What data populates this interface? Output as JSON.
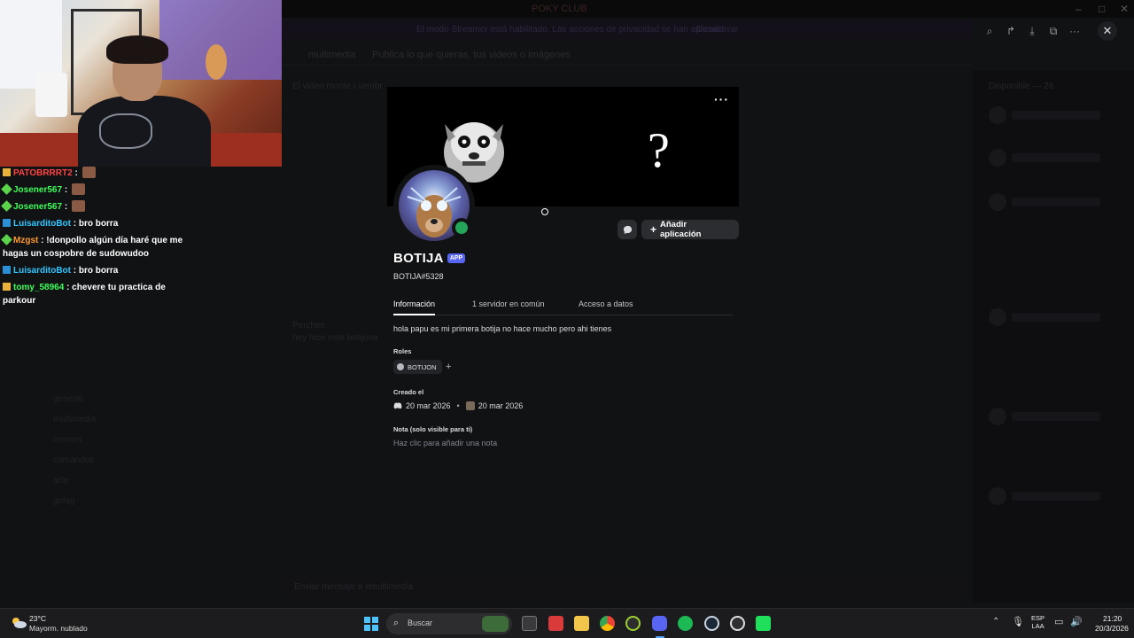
{
  "window": {
    "title": "POKY CLUB"
  },
  "background": {
    "banner_text": "El modo Streamer está habilitado. Las acciones de privacidad se han aplicado.",
    "banner_button": "Desactivar",
    "channel_header": "multimedia",
    "channel_topic": "Publica lo que quieras, tus videos o imágenes",
    "members_header": "Disponible — 26",
    "channels": [
      "general",
      "multimedia",
      "memes",
      "comandos",
      "arte",
      "gulag"
    ],
    "message_preview": "El video monte i sembr",
    "message_author": "Perchee",
    "message_body": "hey hice este botijona",
    "msg_placeholder": "Enviar mensaje a #multimedia"
  },
  "viewer_tools": [
    "zoom-icon",
    "share-icon",
    "download-icon",
    "open-external-icon",
    "more-icon"
  ],
  "chat": [
    {
      "user": "PATOBRRRT2",
      "color": "#ff4444",
      "badge": "#e8b33a",
      "text": "",
      "emote": true
    },
    {
      "user": "Josener567",
      "color": "#3cff5a",
      "badge": "#5bd34a",
      "text": "",
      "emote": true
    },
    {
      "user": "Josener567",
      "color": "#3cff5a",
      "badge": "#5bd34a",
      "text": "",
      "emote": true
    },
    {
      "user": "LuisarditoBot",
      "color": "#2ec7ff",
      "badge": "#2b8fd6",
      "text": "bro borra",
      "emote": false
    },
    {
      "user": "Mzgst",
      "color": "#ff9b2e",
      "badge": "#5bd34a",
      "text": "!donpollo algún día haré que me hagas un cospobre de sudowudoo",
      "emote": false
    },
    {
      "user": "LuisarditoBot",
      "color": "#2ec7ff",
      "badge": "#2b8fd6",
      "text": "bro borra",
      "emote": false
    },
    {
      "user": "tomy_58964",
      "color": "#3cff5a",
      "badge": "#e8b33a",
      "text": "chevere tu practica de parkour",
      "emote": false
    }
  ],
  "profile": {
    "display_name": "BOTIJA",
    "app_badge": "APP",
    "username": "BOTIJA#5328",
    "banner_symbol": "?",
    "more": "···",
    "add_app_label": "Añadir aplicación",
    "tabs": [
      "Información",
      "1 servidor en común",
      "Acceso a datos"
    ],
    "bio": "hola papu es mi primera botija no hace mucho pero ahi tienes",
    "roles_title": "Roles",
    "role": "BOTIJON",
    "created_title": "Creado el",
    "created_discord": "20 mar 2026",
    "created_server": "20 mar 2026",
    "note_title": "Nota (solo visible para ti)",
    "note_placeholder": "Haz clic para añadir una nota",
    "status_color": "#23a55a",
    "accent_badge_color": "#5865f2"
  },
  "taskbar": {
    "temperature": "23°C",
    "weather": "Mayorm. nublado",
    "search_placeholder": "Buscar",
    "lang_line1": "ESP",
    "lang_line2": "LAA",
    "time": "21:20",
    "date": "20/3/2026",
    "apps": [
      "windows-start",
      "file-explorer",
      "media-app",
      "folder",
      "chrome",
      "xbox",
      "discord",
      "spotify",
      "steam",
      "obs",
      "game-app"
    ]
  }
}
